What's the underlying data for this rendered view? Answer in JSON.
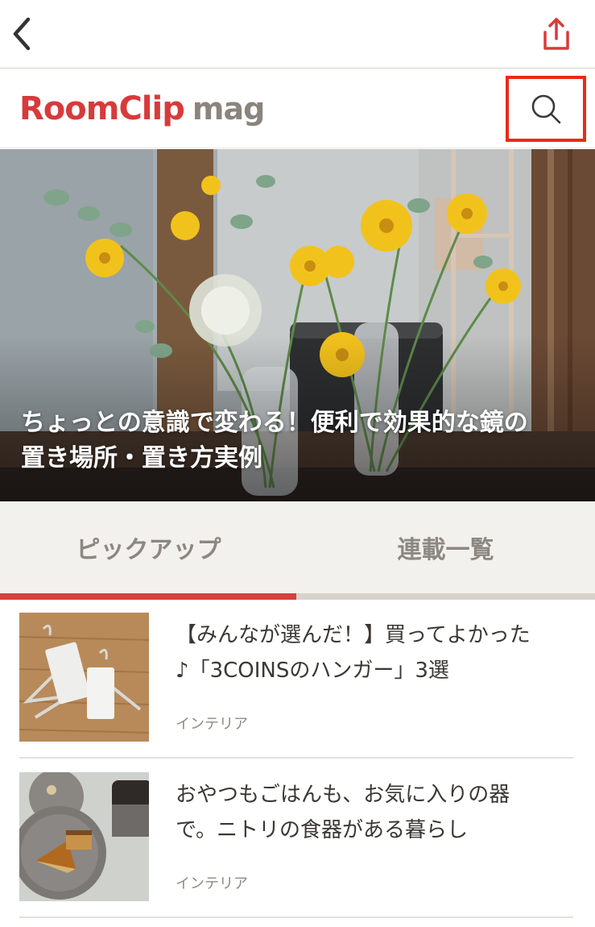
{
  "nav": {
    "back_icon": "chevron-left-icon",
    "share_icon": "share-icon",
    "accent_color": "#d83a3a"
  },
  "header": {
    "logo_brand": "RoomClip",
    "logo_mag": "mag",
    "search_icon": "search-icon",
    "highlight_color": "#ea2a16"
  },
  "hero": {
    "title_line1": "ちょっとの意識で変わる！便利で効果的な鏡の",
    "title_line2": "置き場所・置き方実例"
  },
  "tabs": [
    {
      "label": "ピックアップ",
      "active": true
    },
    {
      "label": "連載一覧",
      "active": false
    }
  ],
  "articles": [
    {
      "title_line1": "【みんなが選んだ！】買ってよかった",
      "title_line2": "♪「3COINSのハンガー」3選",
      "category": "インテリア"
    },
    {
      "title_line1": "おやつもごはんも、お気に入りの器",
      "title_line2": "で。ニトリの食器がある暮らし",
      "category": "インテリア"
    }
  ]
}
